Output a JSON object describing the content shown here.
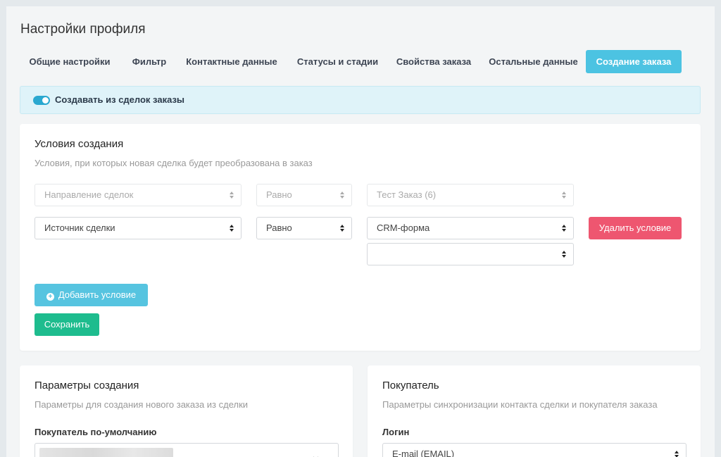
{
  "page": {
    "title": "Настройки профиля"
  },
  "tabs": [
    {
      "label": "Общие настройки",
      "active": false
    },
    {
      "label": "Фильтр",
      "active": false
    },
    {
      "label": "Контактные данные",
      "active": false
    },
    {
      "label": "Статусы и стадии",
      "active": false
    },
    {
      "label": "Свойства заказа",
      "active": false
    },
    {
      "label": "Остальные данные",
      "active": false
    },
    {
      "label": "Создание заказа",
      "active": true
    }
  ],
  "toggle": {
    "label": "Создавать из сделок заказы",
    "enabled": true
  },
  "conditions": {
    "title": "Условия создания",
    "subtitle": "Условия, при которых новая сделка будет преобразована в заказ",
    "row1": {
      "field": "Направление сделок",
      "operator": "Равно",
      "value": "Тест Заказ (6)"
    },
    "row2": {
      "field": "Источник сделки",
      "operator": "Равно",
      "value": "CRM-форма",
      "value2": "",
      "delete_label": "Удалить условие"
    },
    "add_label": "Добавить условие",
    "save_label": "Сохранить"
  },
  "params": {
    "title": "Параметры создания",
    "subtitle": "Параметры для создания нового заказа из сделки",
    "buyer_label": "Покупатель по-умолчанию"
  },
  "buyer": {
    "title": "Покупатель",
    "subtitle": "Параметры синхронизации контакта сделки и покупателя заказа",
    "login_label": "Логин",
    "login_value": "E-mail (EMAIL)"
  },
  "colors": {
    "accent": "#4cc3e2",
    "danger": "#ee5670",
    "success": "#1ebc8e",
    "info": "#56c4e0"
  }
}
